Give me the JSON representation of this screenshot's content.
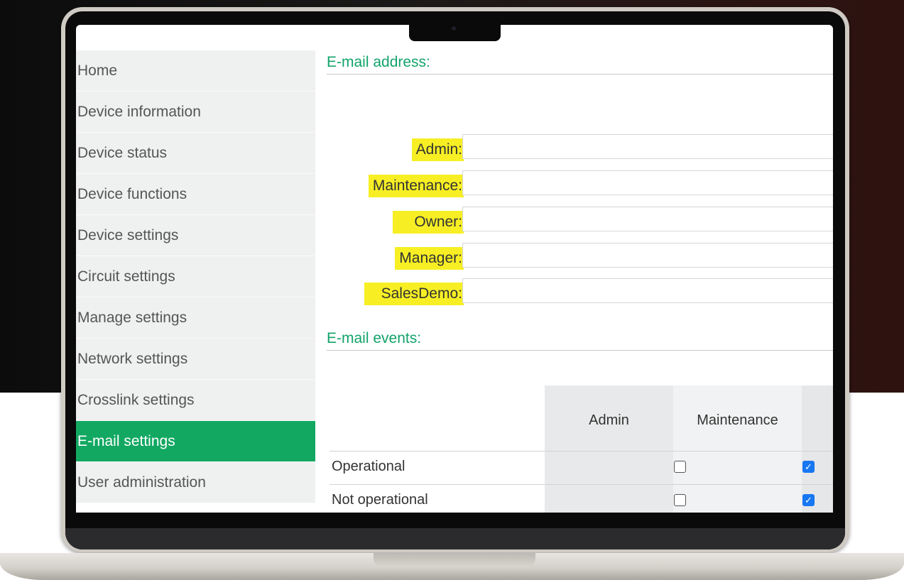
{
  "sidebar": {
    "items": [
      {
        "label": "Home"
      },
      {
        "label": "Device information"
      },
      {
        "label": "Device status"
      },
      {
        "label": "Device functions"
      },
      {
        "label": "Device settings"
      },
      {
        "label": "Circuit settings"
      },
      {
        "label": "Manage settings"
      },
      {
        "label": "Network settings"
      },
      {
        "label": "Crosslink settings"
      },
      {
        "label": "E-mail settings"
      },
      {
        "label": "User administration"
      }
    ],
    "active_index": 9
  },
  "email_address": {
    "title": "E-mail address:",
    "fields": [
      {
        "label": "Admin:",
        "value": ""
      },
      {
        "label": "Maintenance:",
        "value": ""
      },
      {
        "label": "Owner:",
        "value": ""
      },
      {
        "label": "Manager:",
        "value": ""
      },
      {
        "label": "SalesDemo:",
        "value": ""
      }
    ]
  },
  "email_events": {
    "title": "E-mail events:",
    "columns": [
      "Admin",
      "Maintenance"
    ],
    "rows": [
      {
        "label": "Operational",
        "admin": false,
        "maintenance": true
      },
      {
        "label": "Not operational",
        "admin": false,
        "maintenance": true
      }
    ]
  },
  "colors": {
    "accent": "#12a862",
    "highlight": "#f7ef24",
    "checkbox_checked": "#1877f2"
  }
}
